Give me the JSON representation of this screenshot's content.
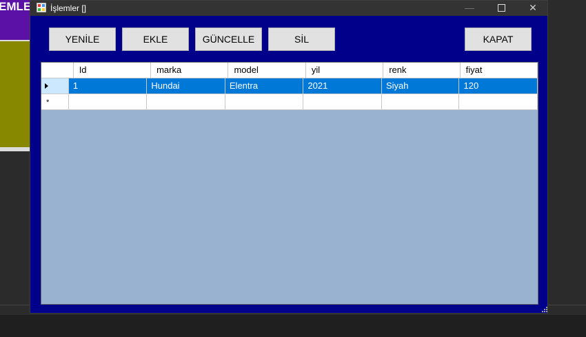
{
  "background_app": {
    "title_fragment": "EMLE"
  },
  "window": {
    "title": "İşlemler []",
    "controls": {
      "minimize": "—",
      "close": "✕"
    }
  },
  "toolbar": {
    "refresh_label": "YENİLE",
    "add_label": "EKLE",
    "update_label": "GÜNCELLE",
    "delete_label": "SİL",
    "close_label": "KAPAT"
  },
  "grid": {
    "columns": [
      "Id",
      "marka",
      "model",
      "yil",
      "renk",
      "fiyat"
    ],
    "rows": [
      [
        "1",
        "Hundai",
        "Elentra",
        "2021",
        "Siyah",
        "120"
      ]
    ]
  },
  "colors": {
    "window_bg": "#00008b",
    "grid_bg": "#98b2cf",
    "selection": "#0078d7",
    "titlebar": "#333333"
  }
}
